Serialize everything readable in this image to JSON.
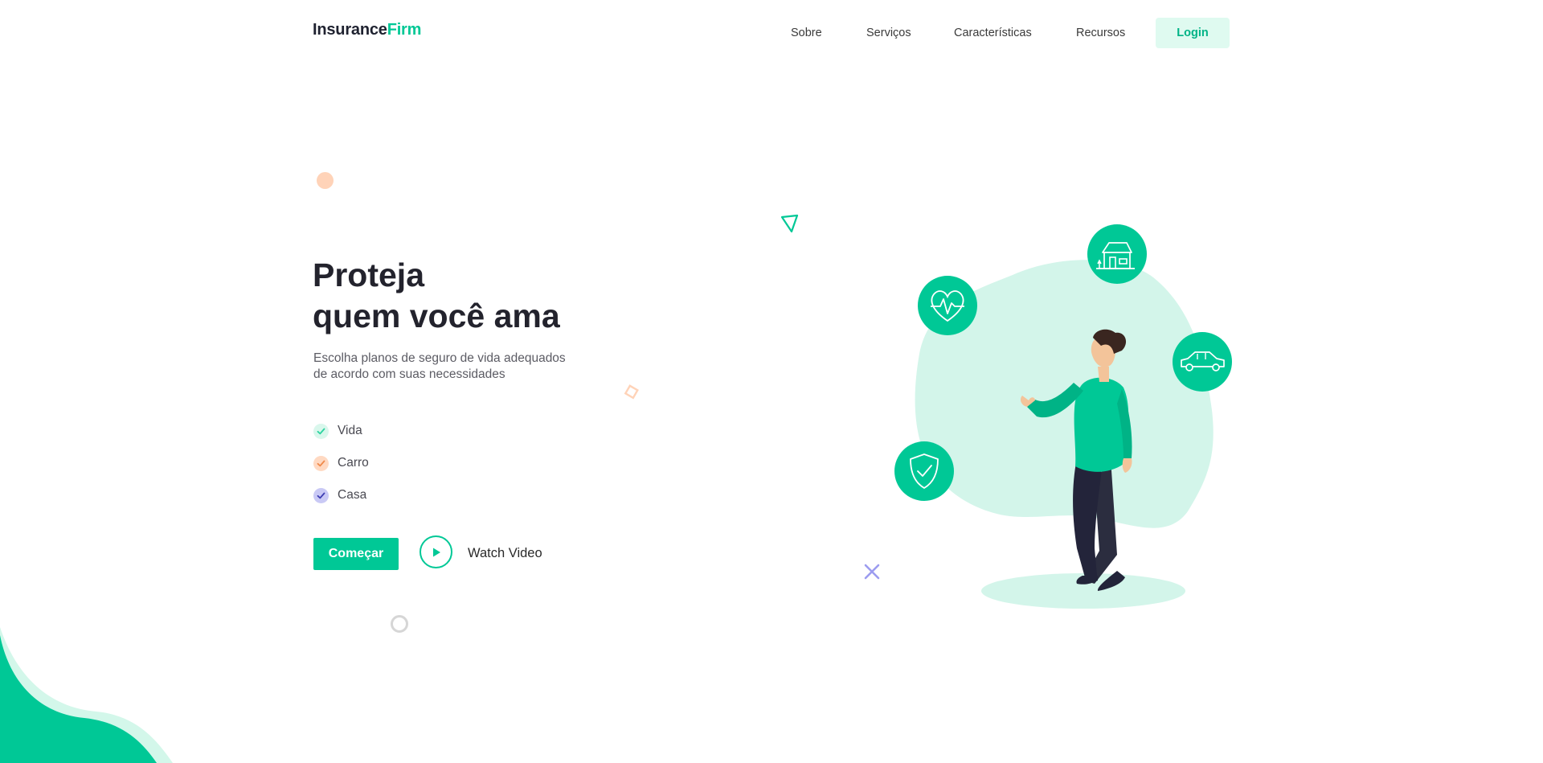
{
  "header": {
    "logo_part1": "Insurance",
    "logo_part2": "Firm",
    "nav": [
      "Sobre",
      "Serviços",
      "Características",
      "Recursos"
    ],
    "login_label": "Login"
  },
  "hero": {
    "title_line1": "Proteja",
    "title_line2": "quem você ama",
    "subtitle": "Escolha planos de seguro de vida adequados de acordo com suas necessidades",
    "features": [
      {
        "label": "Vida",
        "icon": "check-icon",
        "color": "#2dd4a0",
        "bg": "#d9f7ec"
      },
      {
        "label": "Carro",
        "icon": "check-icon",
        "color": "#f08a4b",
        "bg": "#ffd9c2"
      },
      {
        "label": "Casa",
        "icon": "check-icon",
        "color": "#3f3fb4",
        "bg": "#c9c9f5"
      }
    ],
    "start_label": "Começar",
    "watch_label": "Watch Video"
  },
  "illustration": {
    "icons": [
      "heart-pulse-icon",
      "house-icon",
      "car-icon",
      "shield-check-icon"
    ]
  },
  "colors": {
    "accent": "#00c896",
    "accent_light": "#d3f5ea",
    "dark": "#23232d"
  }
}
